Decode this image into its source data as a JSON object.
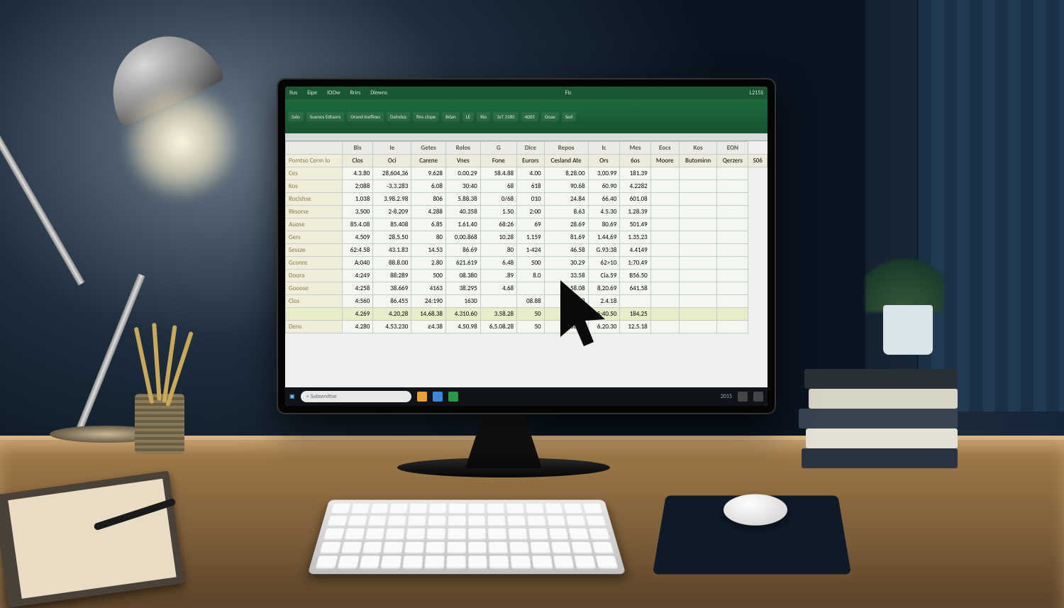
{
  "app": {
    "menu": [
      "Ilus",
      "Eipe",
      "IOOw",
      "Rrirs",
      "Dlewns"
    ],
    "title_center": "Fic",
    "title_right": "L215S",
    "ribbon_items": [
      "Salo",
      "Suenos Edtaors",
      "Orand Ineflnes",
      "Dalndus",
      "fins clope",
      "Bdan",
      "LE",
      "Rio",
      "1sT 2185",
      "4005",
      "Goae",
      "Sed"
    ]
  },
  "sheet": {
    "headers": [
      "",
      "Bis",
      "Ie",
      "Getes",
      "Rolos",
      "G",
      "Dice",
      "Repos",
      "Ic",
      "Mes",
      "Eocs",
      "Kos",
      "EON"
    ],
    "corner": "Pomtso Cerm lo",
    "sub_headers": [
      "Clos",
      "Oci",
      "Carene",
      "Vnes",
      "Fone",
      "Eurors",
      "Cesland Ate",
      "Ors",
      "6os",
      "Moore",
      "Butominn",
      "Qerzers",
      "S06"
    ],
    "rows": [
      {
        "hdr": "Ces",
        "cells": [
          "4.3.80",
          "28,604,36",
          "9.628",
          "0.00.29",
          "58.4.88",
          "4.00",
          "8,28.00",
          "3,00.99",
          "181.39"
        ]
      },
      {
        "hdr": "Kos",
        "cells": [
          "2:088",
          "-3.3.283",
          "6.08",
          "30:40",
          "68",
          "618",
          "90.68",
          "60.90",
          "4.2282"
        ]
      },
      {
        "hdr": "Roclshse",
        "cells": [
          "1.038",
          "3.98.2.98",
          "806",
          "5.88.38",
          "0/68",
          "010",
          "24.84",
          "66.40",
          "601.08"
        ]
      },
      {
        "hdr": "Rksorse",
        "cells": [
          "3.500",
          "2-8.209",
          "4.288",
          "40.358",
          "1.50",
          "2:00",
          "8.63",
          "4.5.30",
          "1.28.39"
        ]
      },
      {
        "hdr": "Auose",
        "cells": [
          "85.4.08",
          "85.408",
          "6.85",
          "1.61.40",
          "68:26",
          "69",
          "28.69",
          "80.69",
          "501.49"
        ]
      },
      {
        "hdr": "Gers",
        "cells": [
          "4.509",
          "28.5.50",
          "80",
          "0.00.868",
          "10.28",
          "1.159",
          "81.69",
          "1.44,69",
          "1.35.23"
        ]
      },
      {
        "hdr": "Sessze",
        "cells": [
          "62:4.58",
          "43.1.83",
          "14.53",
          "86.69",
          "80",
          "1-424",
          "46.58",
          "G.93:38",
          "4.4149"
        ]
      },
      {
        "hdr": "Gconre",
        "cells": [
          "A:040",
          "88.8.00",
          "2.80",
          "621.619",
          "6.48",
          "500",
          "30.29",
          "62>10",
          "1:70.49"
        ]
      },
      {
        "hdr": "Doora",
        "cells": [
          "4:249",
          "88:289",
          "500",
          "08.380",
          ".89",
          "8.0",
          "33.58",
          "Cia.59",
          "B56.50"
        ]
      },
      {
        "hdr": "Gooose",
        "cells": [
          "4:258",
          "38.669",
          "4163",
          "38.295",
          "4.68",
          "",
          "58.08",
          "8,20.69",
          "641.58"
        ]
      },
      {
        "hdr": "Clos",
        "cells": [
          "4:560",
          "86.455",
          "24:190",
          "1630",
          "",
          "08.88",
          "1.20.18",
          "2.4.18"
        ]
      },
      {
        "hdr": "",
        "cells": [
          "4.269",
          "4.20,28",
          "14.68.38",
          "4.310.60",
          "3.58.28",
          "50",
          "461.40",
          "5:40.50",
          "184.25"
        ]
      },
      {
        "hdr": "Dens",
        "cells": [
          "4.280",
          "4.53.230",
          "£4.38",
          "4.50.98",
          "6.5.08.28",
          "50",
          "4.88.20",
          "6.20.30",
          "12.5.18"
        ]
      }
    ]
  },
  "taskbar": {
    "search_placeholder": "Subsenitise",
    "right": "2015"
  }
}
